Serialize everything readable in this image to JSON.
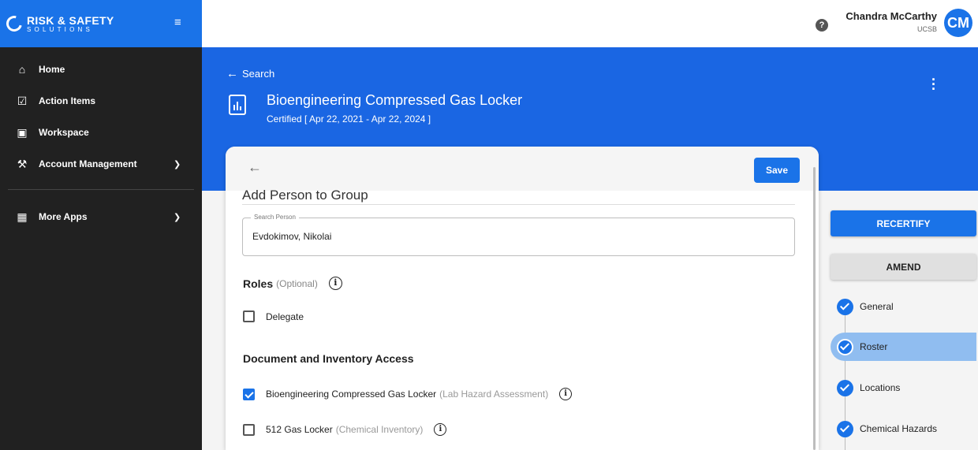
{
  "brand": {
    "line1": "RISK & SAFETY",
    "line2": "SOLUTIONS",
    "color": "#1a73e8"
  },
  "sidebar": {
    "items": [
      {
        "label": "Home",
        "icon": "home-icon"
      },
      {
        "label": "Action Items",
        "icon": "checkbox-icon"
      },
      {
        "label": "Workspace",
        "icon": "briefcase-icon"
      },
      {
        "label": "Account Management",
        "icon": "wrench-icon"
      }
    ],
    "more_apps": {
      "label": "More Apps",
      "icon": "grid-icon"
    }
  },
  "user": {
    "name": "Chandra McCarthy",
    "org": "UCSB",
    "initials": "CM"
  },
  "header": {
    "back_label": "Search",
    "title": "Bioengineering Compressed Gas Locker",
    "subtitle": "Certified [ Apr 22, 2021 - Apr 22, 2024 ]"
  },
  "modal": {
    "save_label": "Save",
    "section_title": "Add Person to Group",
    "search_label": "Search Person",
    "search_value": "Evdokimov, Nikolai",
    "roles_title": "Roles",
    "roles_optional": "(Optional)",
    "roles": [
      {
        "label": "Delegate",
        "checked": false
      }
    ],
    "access_title": "Document and Inventory Access",
    "access": [
      {
        "label": "Bioengineering Compressed Gas Locker",
        "type": "(Lab Hazard Assessment)",
        "checked": true
      },
      {
        "label": "512 Gas Locker",
        "type": "(Chemical Inventory)",
        "checked": false
      }
    ]
  },
  "actions": {
    "recertify": "RECERTIFY",
    "amend": "AMEND"
  },
  "steps": [
    {
      "label": "General",
      "done": true
    },
    {
      "label": "Roster",
      "done": true,
      "active": true
    },
    {
      "label": "Locations",
      "done": true
    },
    {
      "label": "Chemical Hazards",
      "done": true
    }
  ]
}
